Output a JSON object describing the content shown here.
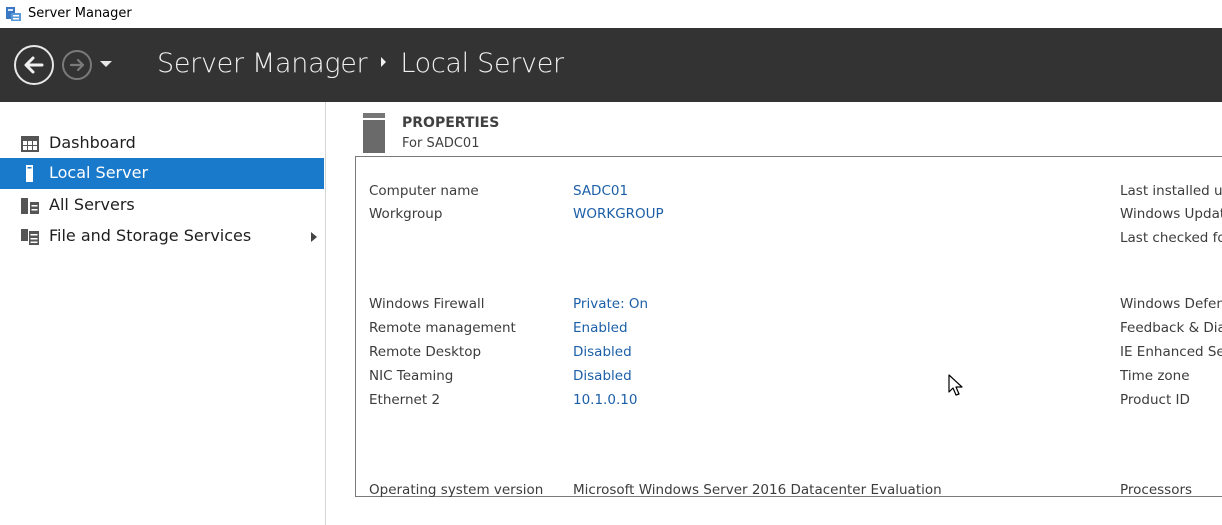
{
  "window": {
    "title": "Server Manager"
  },
  "header": {
    "app_name": "Server Manager",
    "page_name": "Local Server"
  },
  "sidebar": {
    "items": [
      {
        "label": "Dashboard",
        "icon": "dashboard-icon",
        "selected": false
      },
      {
        "label": "Local Server",
        "icon": "server-icon",
        "selected": true
      },
      {
        "label": "All Servers",
        "icon": "servers-icon",
        "selected": false
      },
      {
        "label": "File and Storage Services",
        "icon": "storage-icon",
        "selected": false,
        "has_submenu": true
      }
    ]
  },
  "properties": {
    "title": "PROPERTIES",
    "subtitle": "For SADC01",
    "left": [
      {
        "label": "Computer name",
        "value": "SADC01"
      },
      {
        "label": "Workgroup",
        "value": "WORKGROUP"
      },
      {
        "label": "Windows Firewall",
        "value": "Private: On"
      },
      {
        "label": "Remote management",
        "value": "Enabled"
      },
      {
        "label": "Remote Desktop",
        "value": "Disabled"
      },
      {
        "label": "NIC Teaming",
        "value": "Disabled"
      },
      {
        "label": "Ethernet 2",
        "value": "10.1.0.10"
      },
      {
        "label": "Operating system version",
        "value": "Microsoft Windows Server 2016 Datacenter Evaluation"
      }
    ],
    "right": [
      {
        "label": "Last installed up"
      },
      {
        "label": "Windows Update"
      },
      {
        "label": "Last checked for"
      },
      {
        "label": "Windows Defend"
      },
      {
        "label": "Feedback & Diag"
      },
      {
        "label": "IE Enhanced Sec"
      },
      {
        "label": "Time zone"
      },
      {
        "label": "Product ID"
      },
      {
        "label": "Processors"
      }
    ]
  },
  "colors": {
    "header_bg": "#333333",
    "selected_bg": "#1979ca",
    "link": "#1c5fa8"
  }
}
